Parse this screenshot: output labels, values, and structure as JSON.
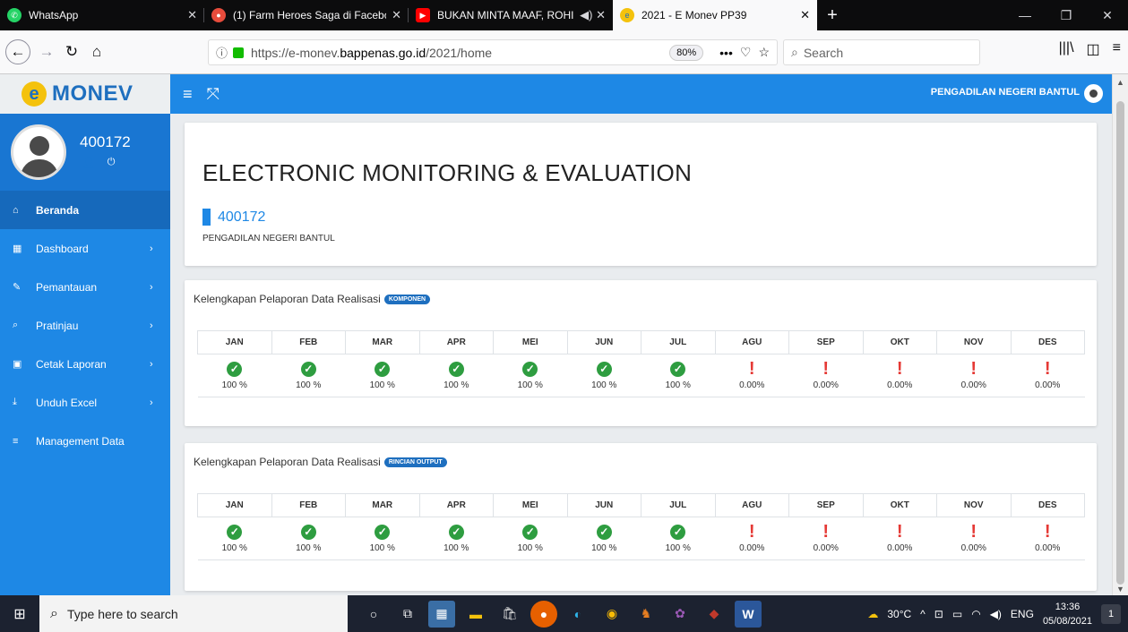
{
  "browser": {
    "tabs": [
      {
        "title": "WhatsApp",
        "icon": "whatsapp-icon",
        "color": "#25d366"
      },
      {
        "title": "(1) Farm Heroes Saga di Facebo",
        "icon": "game-icon",
        "color": "#e74c3c"
      },
      {
        "title": "BUKAN MINTA MAAF, ROHI",
        "icon": "youtube-icon",
        "color": "#ff0000"
      },
      {
        "title": "2021 - E Monev PP39",
        "icon": "emonev-icon",
        "color": "#f4c20d"
      }
    ],
    "url_prefix": "https://e-monev.",
    "url_domain": "bappenas.go.id",
    "url_suffix": "/2021/home",
    "zoom": "80%",
    "search_placeholder": "Search"
  },
  "app": {
    "logo_letter": "e",
    "logo_text": "MONEV",
    "user": "PENGADILAN NEGERI BANTUL"
  },
  "sidebar": {
    "profile_id": "400172",
    "items": [
      {
        "label": "Beranda",
        "icon": "home-icon",
        "glyph": "⌂",
        "active": true,
        "chevron": ""
      },
      {
        "label": "Dashboard",
        "icon": "dashboard-icon",
        "glyph": "■",
        "active": false,
        "chevron": "›"
      },
      {
        "label": "Pemantauan",
        "icon": "pencil-icon",
        "glyph": "✎",
        "active": false,
        "chevron": "›"
      },
      {
        "label": "Pratinjau",
        "icon": "search-icon",
        "glyph": "⌕",
        "active": false,
        "chevron": "›"
      },
      {
        "label": "Cetak Laporan",
        "icon": "print-icon",
        "glyph": "▣",
        "active": false,
        "chevron": "›"
      },
      {
        "label": "Unduh Excel",
        "icon": "download-icon",
        "glyph": "⤓",
        "active": false,
        "chevron": "›"
      },
      {
        "label": "Management Data",
        "icon": "list-icon",
        "glyph": "≡",
        "active": false,
        "chevron": ""
      }
    ]
  },
  "main": {
    "title": "ELECTRONIC MONITORING & EVALUATION",
    "unit_id": "400172",
    "unit_name": "PENGADILAN NEGERI BANTUL",
    "months": [
      "JAN",
      "FEB",
      "MAR",
      "APR",
      "MEI",
      "JUN",
      "JUL",
      "AGU",
      "SEP",
      "OKT",
      "NOV",
      "DES"
    ],
    "cards": [
      {
        "title": "Kelengkapan Pelaporan Data Realisasi",
        "badge": "KOMPONEN",
        "values": [
          "100 %",
          "100 %",
          "100 %",
          "100 %",
          "100 %",
          "100 %",
          "100 %",
          "0.00%",
          "0.00%",
          "0.00%",
          "0.00%",
          "0.00%"
        ],
        "status": [
          "ok",
          "ok",
          "ok",
          "ok",
          "ok",
          "ok",
          "ok",
          "bad",
          "bad",
          "bad",
          "bad",
          "bad"
        ]
      },
      {
        "title": "Kelengkapan Pelaporan Data Realisasi",
        "badge": "RINCIAN OUTPUT",
        "values": [
          "100 %",
          "100 %",
          "100 %",
          "100 %",
          "100 %",
          "100 %",
          "100 %",
          "0.00%",
          "0.00%",
          "0.00%",
          "0.00%",
          "0.00%"
        ],
        "status": [
          "ok",
          "ok",
          "ok",
          "ok",
          "ok",
          "ok",
          "ok",
          "bad",
          "bad",
          "bad",
          "bad",
          "bad"
        ]
      }
    ]
  },
  "taskbar": {
    "search_placeholder": "Type here to search",
    "temperature": "30°C",
    "language": "ENG",
    "time": "13:36",
    "date": "05/08/2021",
    "notifications": "1"
  },
  "colors": {
    "primary": "#1e88e5",
    "success": "#2e9d40",
    "danger": "#e53935"
  }
}
